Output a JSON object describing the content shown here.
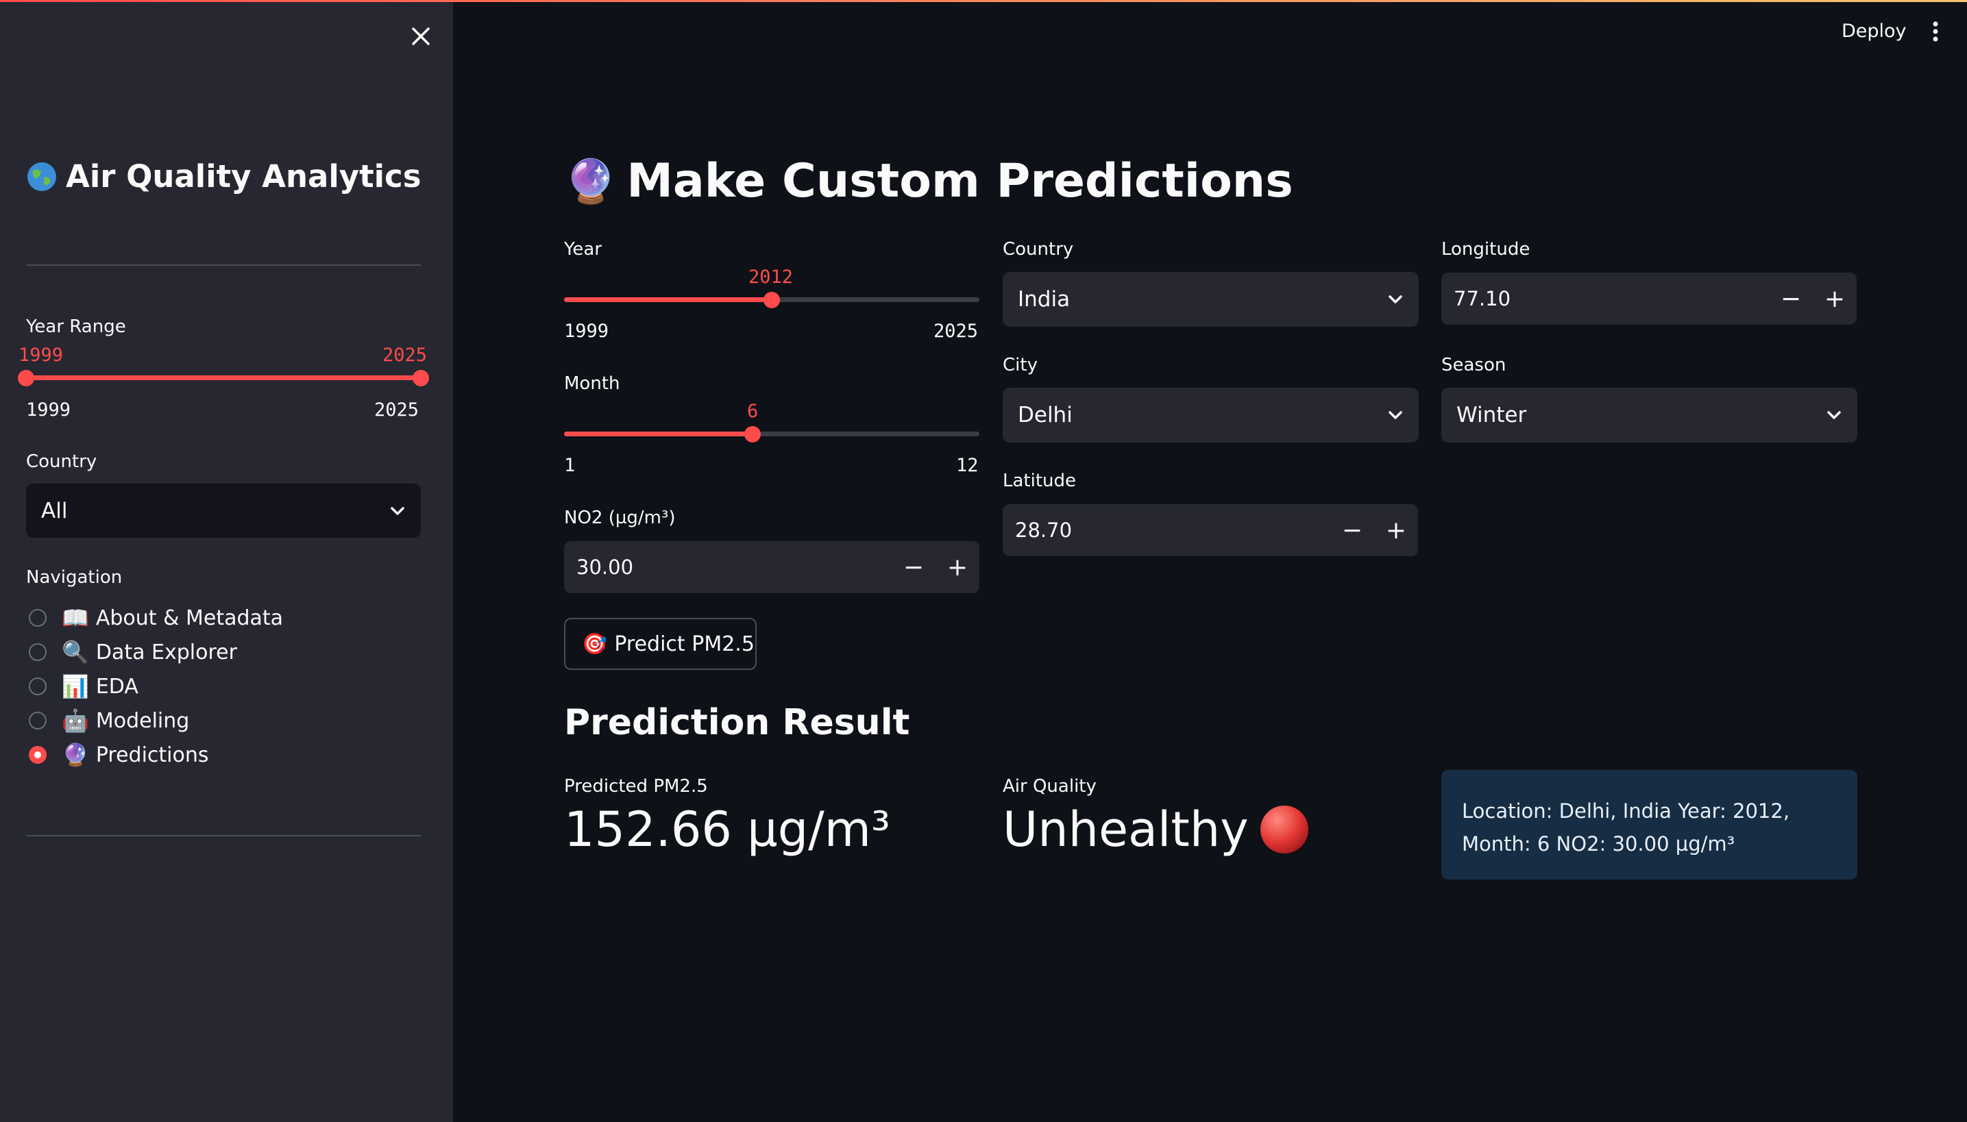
{
  "header": {
    "deploy_label": "Deploy"
  },
  "sidebar": {
    "title": "Air Quality Analytics",
    "title_icon": "globe-icon",
    "year_range": {
      "label": "Year Range",
      "low": 1999,
      "high": 2025,
      "min_label": "1999",
      "max_label": "2025",
      "low_label": "1999",
      "high_label": "2025"
    },
    "country": {
      "label": "Country",
      "value": "All"
    },
    "navigation": {
      "label": "Navigation",
      "items": [
        {
          "label": "About & Metadata",
          "icon": "open-book-icon",
          "selected": false
        },
        {
          "label": "Data Explorer",
          "icon": "magnifier-icon",
          "selected": false
        },
        {
          "label": "EDA",
          "icon": "bar-chart-icon",
          "selected": false
        },
        {
          "label": "Modeling",
          "icon": "robot-icon",
          "selected": false
        },
        {
          "label": "Predictions",
          "icon": "crystal-ball-icon",
          "selected": true
        }
      ]
    }
  },
  "main": {
    "title": "Make Custom Predictions",
    "title_icon": "crystal-ball-icon",
    "year": {
      "label": "Year",
      "value": "2012",
      "min": "1999",
      "max": "2025",
      "fraction": 0.5
    },
    "month": {
      "label": "Month",
      "value": "6",
      "min": "1",
      "max": "12",
      "fraction": 0.4545
    },
    "no2": {
      "label": "NO2 (µg/m³)",
      "value": "30.00"
    },
    "country": {
      "label": "Country",
      "value": "India"
    },
    "city": {
      "label": "City",
      "value": "Delhi"
    },
    "latitude": {
      "label": "Latitude",
      "value": "28.70"
    },
    "longitude": {
      "label": "Longitude",
      "value": "77.10"
    },
    "season": {
      "label": "Season",
      "value": "Winter"
    },
    "predict_button": {
      "label": "Predict PM2.5",
      "icon": "target-icon"
    },
    "result": {
      "heading": "Prediction Result",
      "pm25_label": "Predicted PM2.5",
      "pm25_value": "152.66 µg/m³",
      "air_quality_label": "Air Quality",
      "air_quality_value": "Unhealthy",
      "air_quality_icon": "red-circle-icon",
      "info_text": "Location: Delhi, India Year: 2012, Month: 6 NO2: 30.00 µg/m³"
    }
  },
  "colors": {
    "accent": "#ff4b4b",
    "background": "#0e1117",
    "sidebar": "#262730",
    "info_bg": "#172d43"
  }
}
